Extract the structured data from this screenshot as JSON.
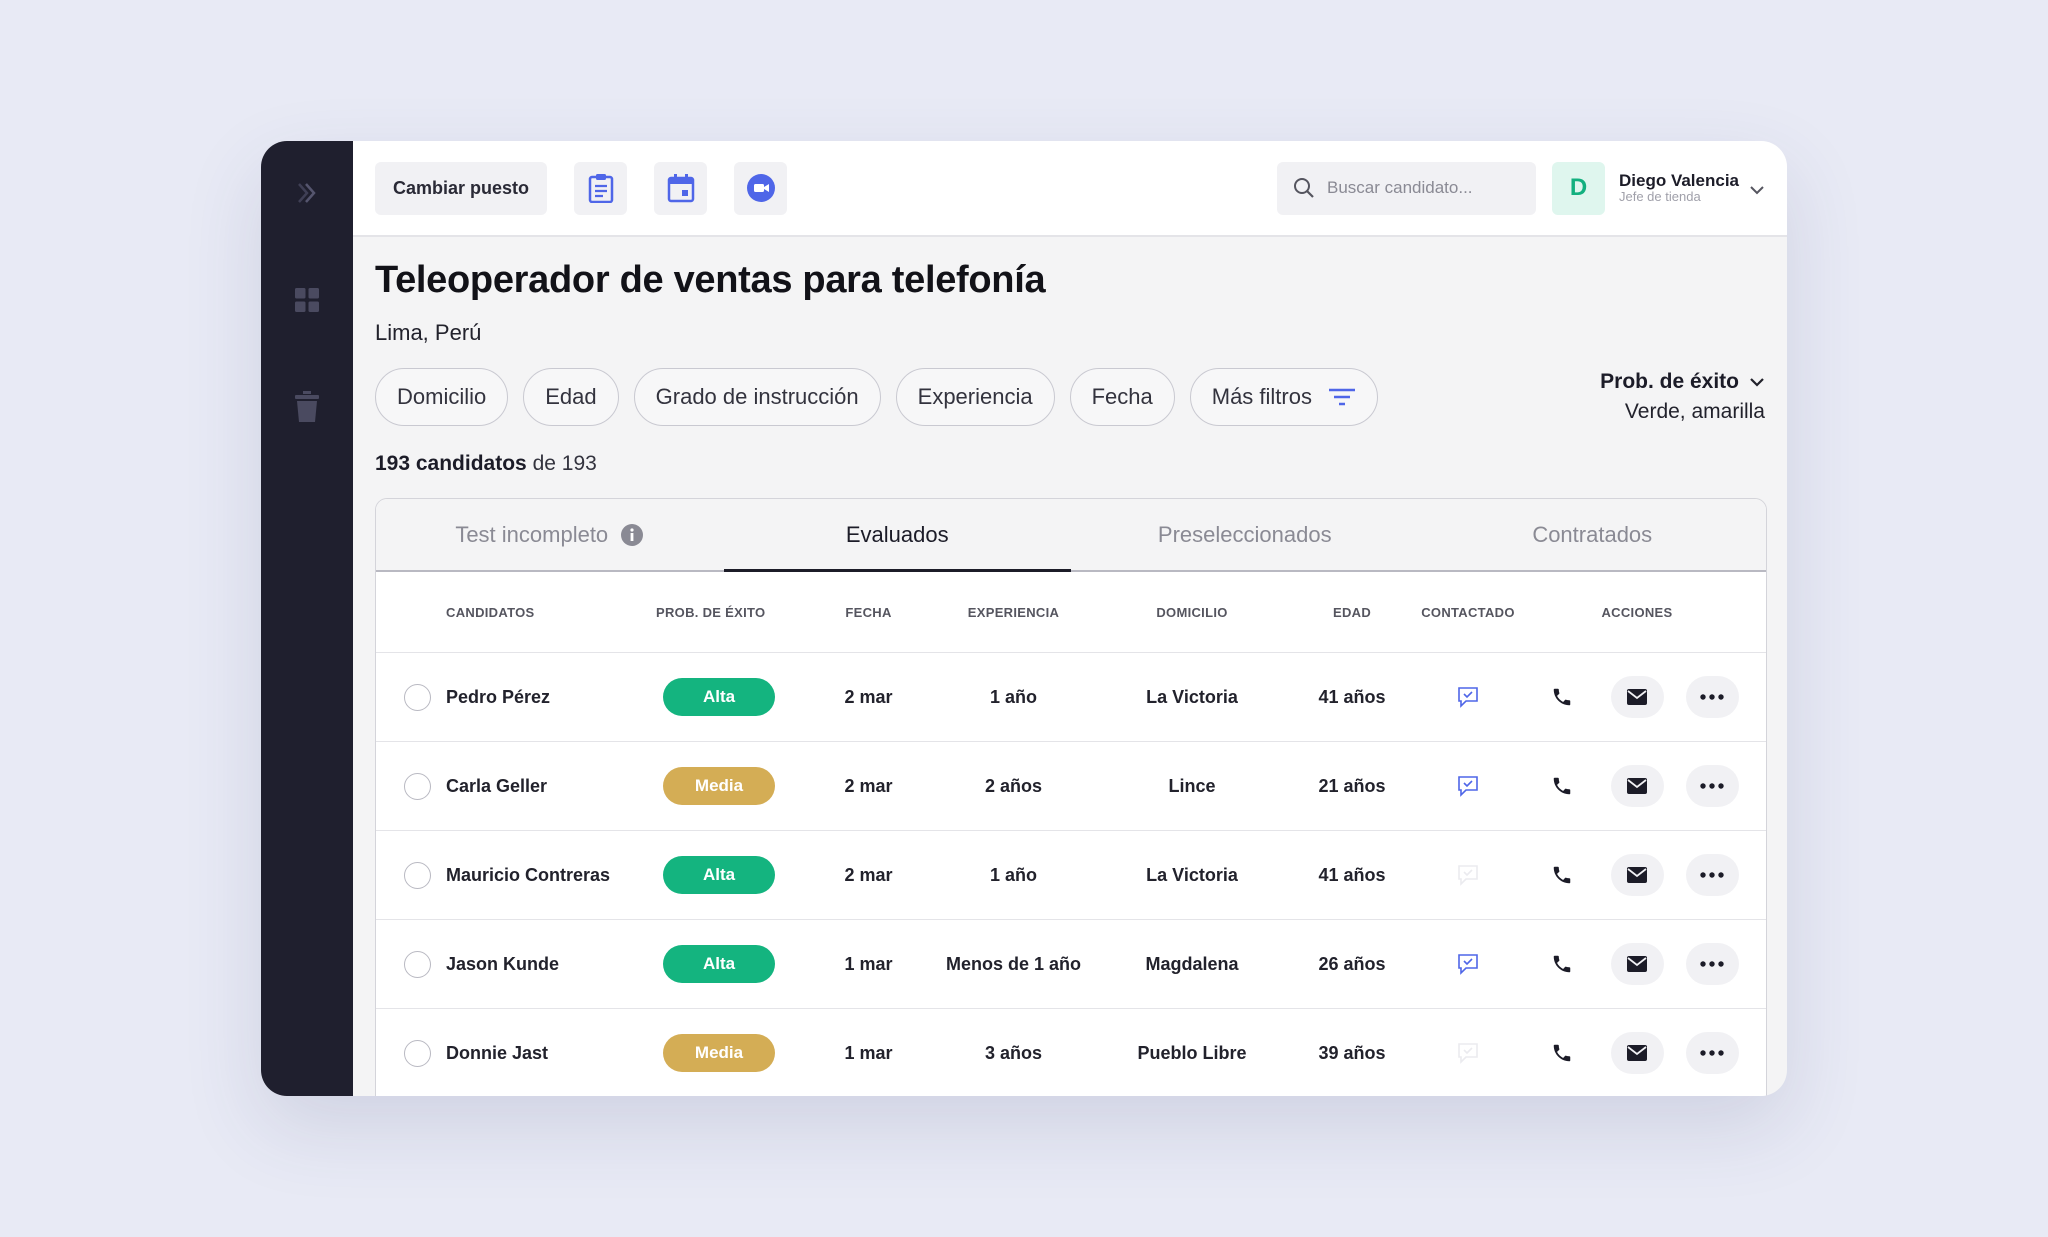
{
  "header": {
    "change_position_label": "Cambiar puesto",
    "tools": [
      "clipboard-icon",
      "calendar-icon",
      "video-icon"
    ],
    "search_placeholder": "Buscar candidato...",
    "user": {
      "initial": "D",
      "name": "Diego Valencia",
      "role": "Jefe de tienda"
    }
  },
  "job": {
    "title": "Teleoperador de ventas para telefonía",
    "location": "Lima, Perú"
  },
  "filters": [
    "Domicilio",
    "Edad",
    "Grado de instrucción",
    "Experiencia",
    "Fecha",
    "Más filtros"
  ],
  "prob_filter": {
    "label": "Prob. de éxito",
    "value": "Verde, amarilla"
  },
  "count": {
    "bold": "193 candidatos",
    "rest": "de 193"
  },
  "tabs": [
    {
      "label": "Test incompleto",
      "active": false
    },
    {
      "label": "Evaluados",
      "active": true
    },
    {
      "label": "Preseleccionados",
      "active": false
    },
    {
      "label": "Contratados",
      "active": false
    }
  ],
  "table": {
    "columns": [
      "CANDIDATOS",
      "PROB. DE ÉXITO",
      "FECHA",
      "EXPERIENCIA",
      "DOMICILIO",
      "EDAD",
      "CONTACTADO",
      "ACCIONES"
    ],
    "rows": [
      {
        "name": "Pedro Pérez",
        "prob": "Alta",
        "date": "2 mar",
        "experience": "1 año",
        "address": "La Victoria",
        "age": "41 años",
        "contacted": true
      },
      {
        "name": "Carla Geller",
        "prob": "Media",
        "date": "2 mar",
        "experience": "2 años",
        "address": "Lince",
        "age": "21 años",
        "contacted": true
      },
      {
        "name": "Mauricio Contreras",
        "prob": "Alta",
        "date": "2 mar",
        "experience": "1 año",
        "address": "La Victoria",
        "age": "41 años",
        "contacted": false
      },
      {
        "name": "Jason Kunde",
        "prob": "Alta",
        "date": "1 mar",
        "experience": "Menos de 1 año",
        "address": "Magdalena",
        "age": "26 años",
        "contacted": true
      },
      {
        "name": "Donnie Jast",
        "prob": "Media",
        "date": "1 mar",
        "experience": "3 años",
        "address": "Pueblo Libre",
        "age": "39 años",
        "contacted": false
      }
    ]
  },
  "colors": {
    "sidebar": "#1f1f2e",
    "accent": "#4f66e8",
    "high": "#14b47f",
    "medium": "#d4ad55",
    "avatar_text": "#13b07f"
  }
}
